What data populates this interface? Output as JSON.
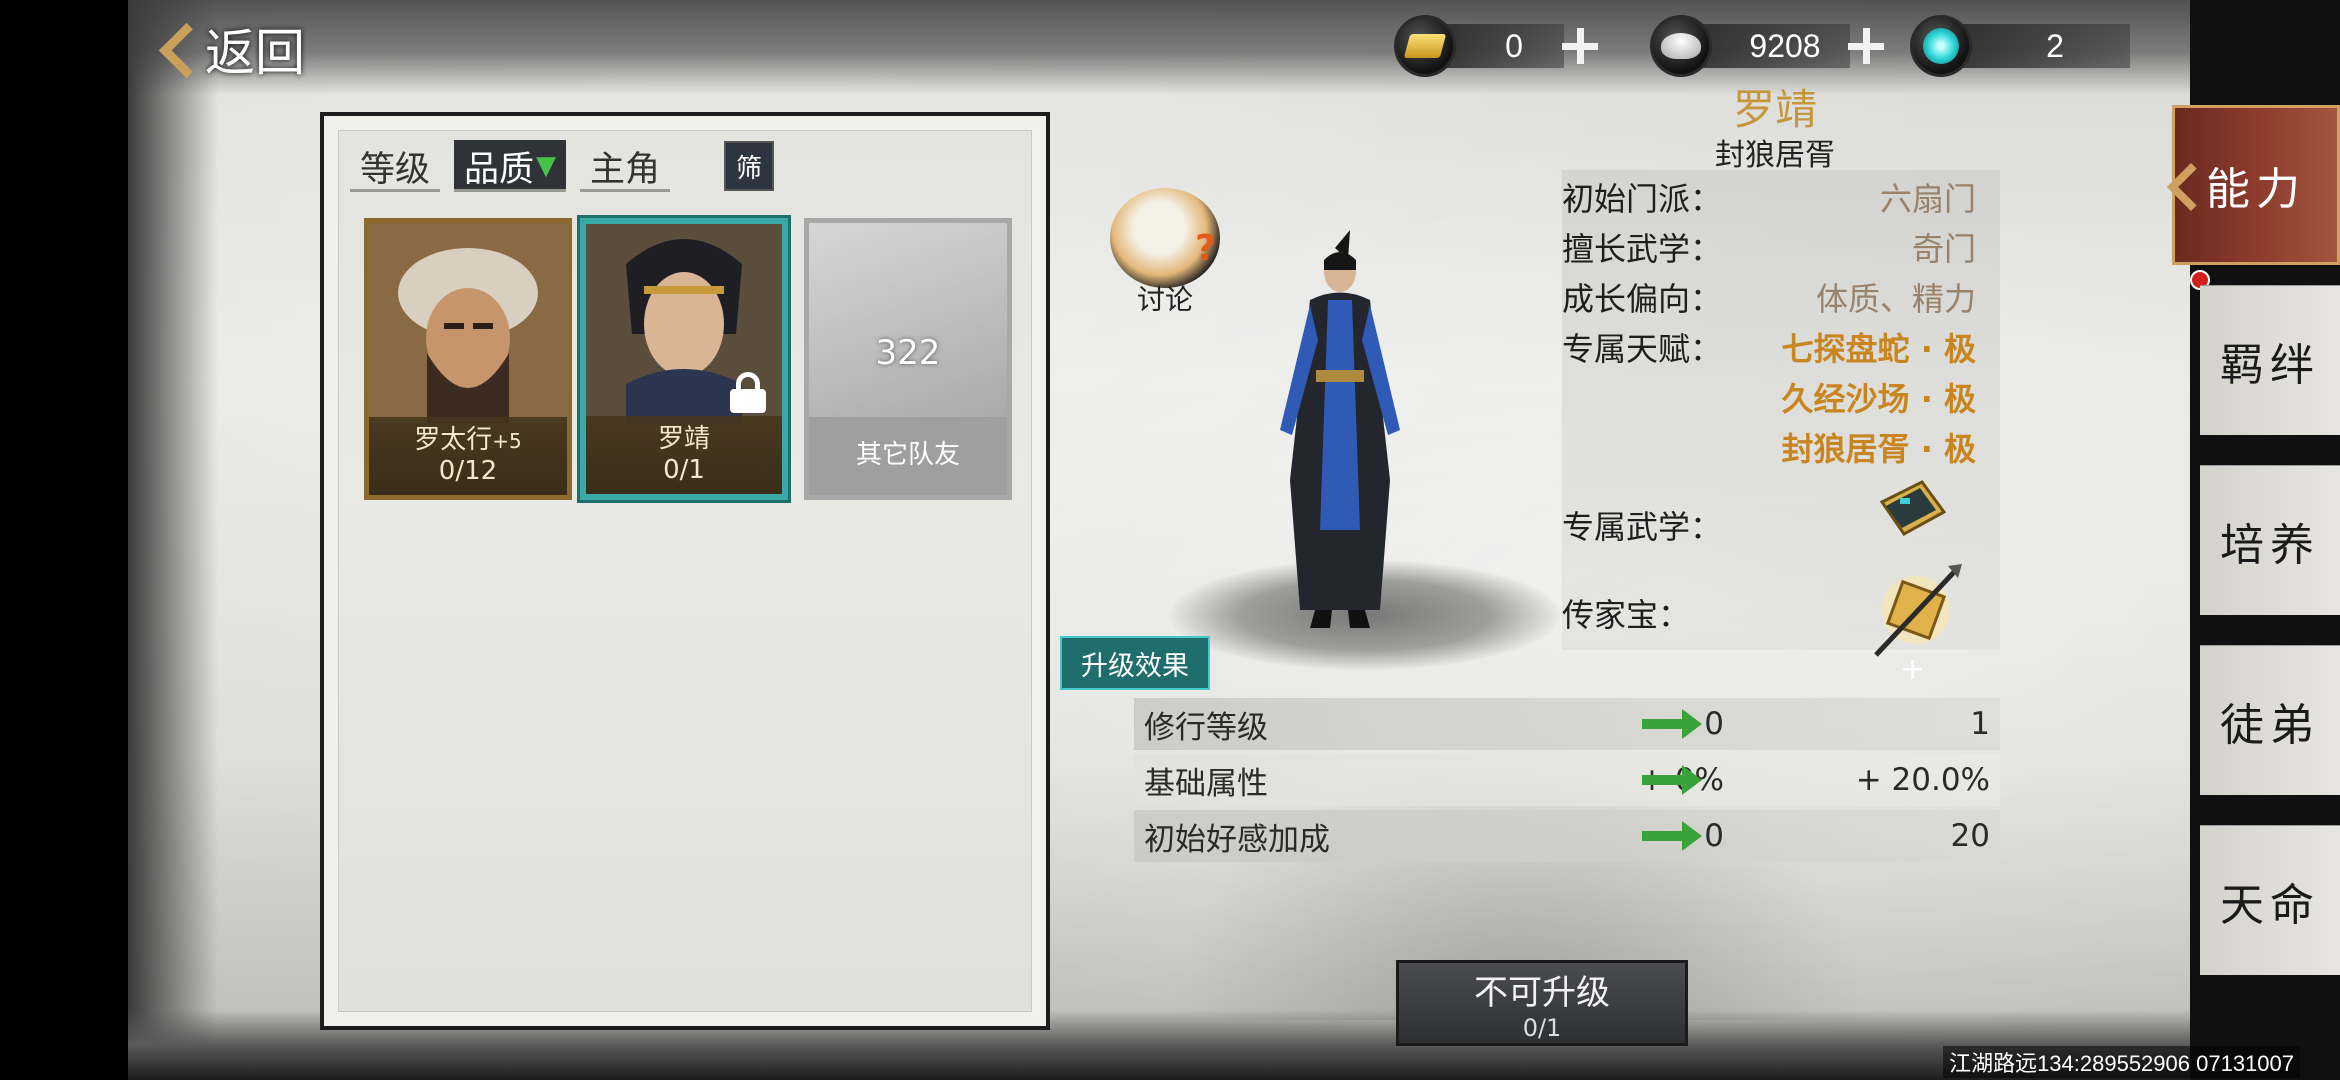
{
  "header": {
    "back_label": "返回",
    "currencies": [
      {
        "icon": "gold-ingot-icon",
        "value": "0"
      },
      {
        "icon": "silver-ingot-icon",
        "value": "9208"
      },
      {
        "icon": "jade-orb-icon",
        "value": "2"
      }
    ]
  },
  "list": {
    "tabs": [
      {
        "label": "等级"
      },
      {
        "label": "品质"
      },
      {
        "label": "主角"
      }
    ],
    "filter_label": "筛",
    "cards": [
      {
        "name": "罗太行",
        "badge": "+5",
        "progress": "0/12"
      },
      {
        "name": "罗靖",
        "progress": "0/1"
      },
      {
        "name": "其它队友",
        "count": "322"
      }
    ]
  },
  "character": {
    "discuss_label": "讨论",
    "name": "罗靖",
    "title": "封狼居胥",
    "info": {
      "sect_label": "初始门派：",
      "sect_value": "六扇门",
      "skill_label": "擅长武学：",
      "skill_value": "奇门",
      "growth_label": "成长偏向：",
      "growth_value": "体质、精力",
      "talent_label": "专属天赋：",
      "talents": [
        "七探盘蛇 · 极",
        "久经沙场 · 极",
        "封狼居胥 · 极"
      ],
      "exclusive_skill_label": "专属武学：",
      "heirloom_label": "传家宝："
    }
  },
  "upgrade": {
    "tag_label": "升级效果",
    "rows": [
      {
        "name": "修行等级",
        "from": "0",
        "to": "1"
      },
      {
        "name": "基础属性",
        "from": "+ 0%",
        "to": "+ 20.0%"
      },
      {
        "name": "初始好感加成",
        "from": "0",
        "to": "20"
      }
    ],
    "button_label": "不可升级",
    "button_progress": "0/1"
  },
  "sidebar": {
    "items": [
      "能力",
      "羁绊",
      "培养",
      "徒弟",
      "天命"
    ]
  },
  "footer": "江湖路远134:289552906 07131007",
  "colors": {
    "accent_teal": "#3aa9a8",
    "gold_text": "#c5963a",
    "talent_orange": "#c88520",
    "active_tab_red": "#8d3b2c"
  }
}
